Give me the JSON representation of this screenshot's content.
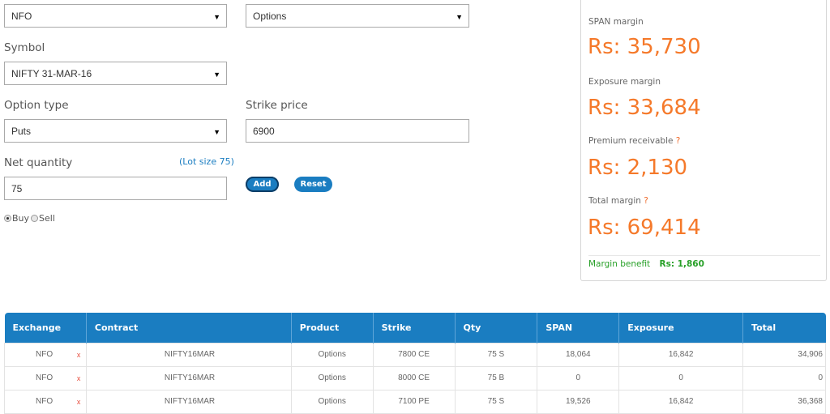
{
  "form": {
    "exchange": "NFO",
    "product": "Options",
    "symbol_label": "Symbol",
    "symbol": "NIFTY 31-MAR-16",
    "option_type_label": "Option type",
    "option_type": "Puts",
    "strike_price_label": "Strike price",
    "strike_price": "6900",
    "net_quantity_label": "Net quantity",
    "net_quantity": "75",
    "lot_size": "(Lot size 75)",
    "add_label": "Add",
    "reset_label": "Reset",
    "buy_label": "Buy",
    "sell_label": "Sell",
    "side_selected": "Buy"
  },
  "summary": {
    "span_label": "SPAN margin",
    "span_value": "Rs: 35,730",
    "exposure_label": "Exposure margin",
    "exposure_value": "Rs: 33,684",
    "premium_label": "Premium receivable",
    "premium_value": "Rs: 2,130",
    "total_label": "Total margin",
    "total_value": "Rs: 69,414",
    "help_mark": "?",
    "benefit_label": "Margin benefit",
    "benefit_value": "Rs: 1,860"
  },
  "table": {
    "headers": [
      "Exchange",
      "Contract",
      "Product",
      "Strike",
      "Qty",
      "SPAN",
      "Exposure",
      "Total"
    ],
    "delete_mark": "x",
    "rows": [
      {
        "exchange": "NFO",
        "contract": "NIFTY16MAR",
        "product": "Options",
        "strike": "7800 CE",
        "qty": "75 S",
        "span": "18,064",
        "exposure": "16,842",
        "total": "34,906"
      },
      {
        "exchange": "NFO",
        "contract": "NIFTY16MAR",
        "product": "Options",
        "strike": "8000 CE",
        "qty": "75 B",
        "span": "0",
        "exposure": "0",
        "total": "0"
      },
      {
        "exchange": "NFO",
        "contract": "NIFTY16MAR",
        "product": "Options",
        "strike": "7100 PE",
        "qty": "75 S",
        "span": "19,526",
        "exposure": "16,842",
        "total": "36,368"
      }
    ]
  },
  "colors": {
    "accent": "#1a7dc1",
    "value_orange": "#f5792a",
    "benefit_green": "#28a028",
    "delete_red": "#e74c3c"
  }
}
